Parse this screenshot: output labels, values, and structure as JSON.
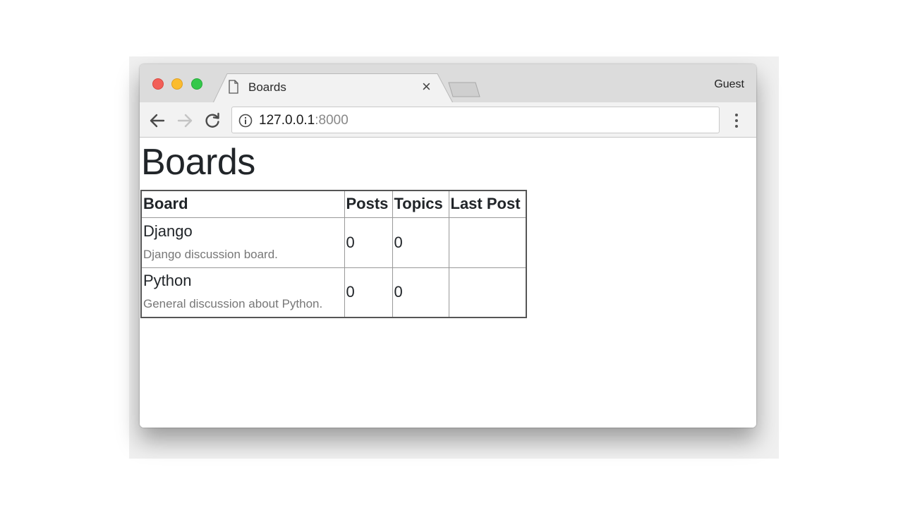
{
  "browser": {
    "tab": {
      "title": "Boards",
      "close_glyph": "×"
    },
    "profile": "Guest",
    "address": {
      "host": "127.0.0.1",
      "port": ":8000"
    },
    "icons": {
      "traffic_close": "#f25f58",
      "traffic_minimize": "#fbbc2e",
      "traffic_maximize": "#34c84a"
    }
  },
  "page": {
    "title": "Boards",
    "table": {
      "headers": [
        "Board",
        "Posts",
        "Topics",
        "Last Post"
      ],
      "rows": [
        {
          "name": "Django",
          "description": "Django discussion board.",
          "posts": "0",
          "topics": "0",
          "last_post": ""
        },
        {
          "name": "Python",
          "description": "General discussion about Python.",
          "posts": "0",
          "topics": "0",
          "last_post": ""
        }
      ]
    }
  }
}
